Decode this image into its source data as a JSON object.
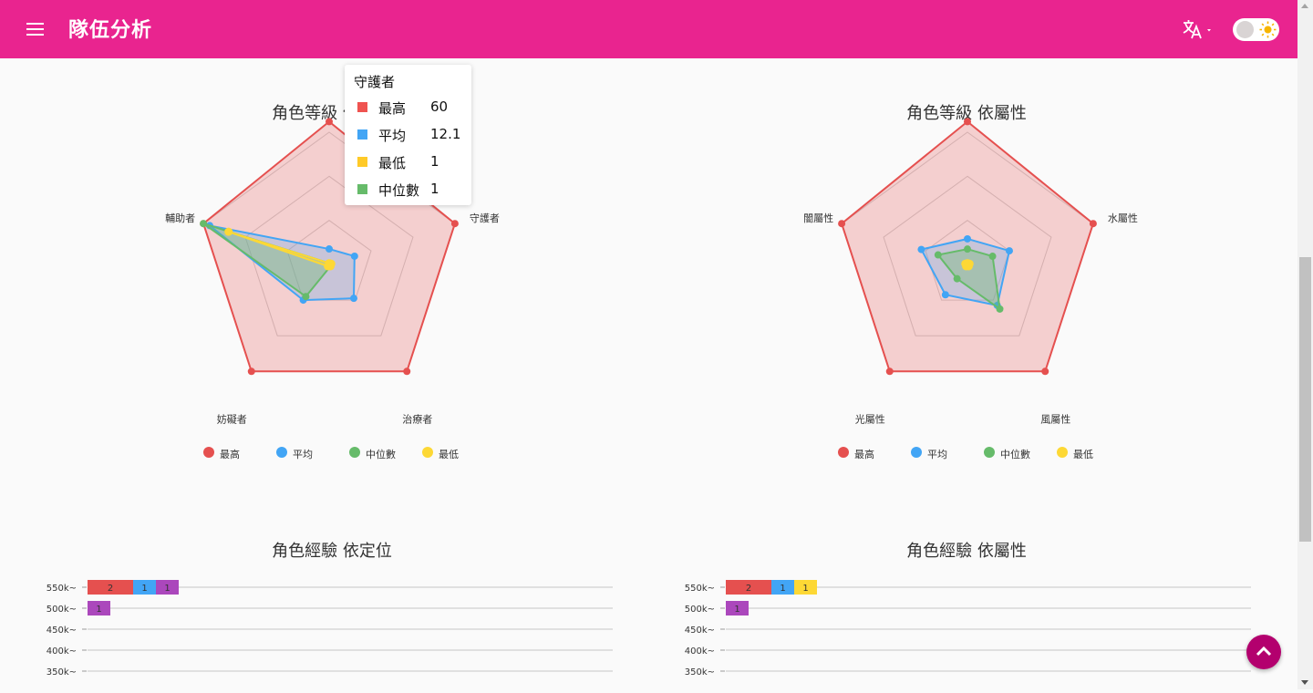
{
  "app": {
    "title": "隊伍分析"
  },
  "header_icons": {
    "menu": "menu-icon",
    "language": "translate-icon",
    "theme": "sun-icon"
  },
  "colors": {
    "appbar": "#e9248f",
    "max": "#e5504f",
    "avg": "#42a5f5",
    "median": "#66bb6a",
    "min": "#fdd835",
    "purple": "#ab47bc",
    "fab": "#b3006e"
  },
  "tooltip": {
    "title": "守護者",
    "rows": [
      {
        "label": "最高",
        "value": "60",
        "color": "#ef5350"
      },
      {
        "label": "平均",
        "value": "12.1",
        "color": "#42a5f5"
      },
      {
        "label": "最低",
        "value": "1",
        "color": "#ffca28"
      },
      {
        "label": "中位數",
        "value": "1",
        "color": "#66bb6a"
      }
    ]
  },
  "legend": [
    {
      "label": "最高",
      "color": "#e5504f"
    },
    {
      "label": "平均",
      "color": "#42a5f5"
    },
    {
      "label": "中位數",
      "color": "#66bb6a"
    },
    {
      "label": "最低",
      "color": "#fdd835"
    }
  ],
  "chart_data": [
    {
      "type": "radar",
      "title": "角色等級 依定位",
      "categories": [
        "守護者",
        "治療者",
        "妨礙者",
        "輔助者"
      ],
      "ylim": [
        0,
        60
      ],
      "series": [
        {
          "name": "最高",
          "values": [
            60,
            60,
            60,
            60
          ]
        },
        {
          "name": "平均",
          "values": [
            12.1,
            19,
            20,
            57
          ]
        },
        {
          "name": "中位數",
          "values": [
            1,
            1,
            18,
            60
          ]
        },
        {
          "name": "最低",
          "values": [
            1,
            1,
            1,
            48
          ]
        }
      ]
    },
    {
      "type": "radar",
      "title": "角色等級 依屬性",
      "categories": [
        "水屬性",
        "風屬性",
        "光屬性",
        "闇屬性"
      ],
      "ylim": [
        0,
        60
      ],
      "series": [
        {
          "name": "最高",
          "values": [
            60,
            60,
            60,
            60
          ]
        },
        {
          "name": "平均",
          "values": [
            20,
            23,
            17,
            22
          ]
        },
        {
          "name": "中位數",
          "values": [
            12,
            25,
            8,
            14
          ]
        },
        {
          "name": "最低",
          "values": [
            1,
            1,
            1,
            1
          ]
        }
      ]
    },
    {
      "type": "bar",
      "title": "角色經驗 依定位",
      "categories": [
        "550k~",
        "500k~",
        "450k~",
        "400k~",
        "350k~"
      ],
      "series": [
        {
          "color": "#e5504f",
          "values": [
            2,
            0,
            0,
            0,
            0
          ]
        },
        {
          "color": "#42a5f5",
          "values": [
            1,
            0,
            0,
            0,
            0
          ]
        },
        {
          "color": "#ab47bc",
          "values": [
            1,
            1,
            0,
            0,
            0
          ]
        }
      ]
    },
    {
      "type": "bar",
      "title": "角色經驗 依屬性",
      "categories": [
        "550k~",
        "500k~",
        "450k~",
        "400k~",
        "350k~"
      ],
      "series": [
        {
          "color": "#e5504f",
          "values": [
            2,
            0,
            0,
            0,
            0
          ]
        },
        {
          "color": "#42a5f5",
          "values": [
            1,
            0,
            0,
            0,
            0
          ]
        },
        {
          "color": "#fdd835",
          "values": [
            1,
            0,
            0,
            0,
            0
          ]
        },
        {
          "color": "#ab47bc",
          "values": [
            0,
            1,
            0,
            0,
            0
          ]
        }
      ]
    }
  ]
}
